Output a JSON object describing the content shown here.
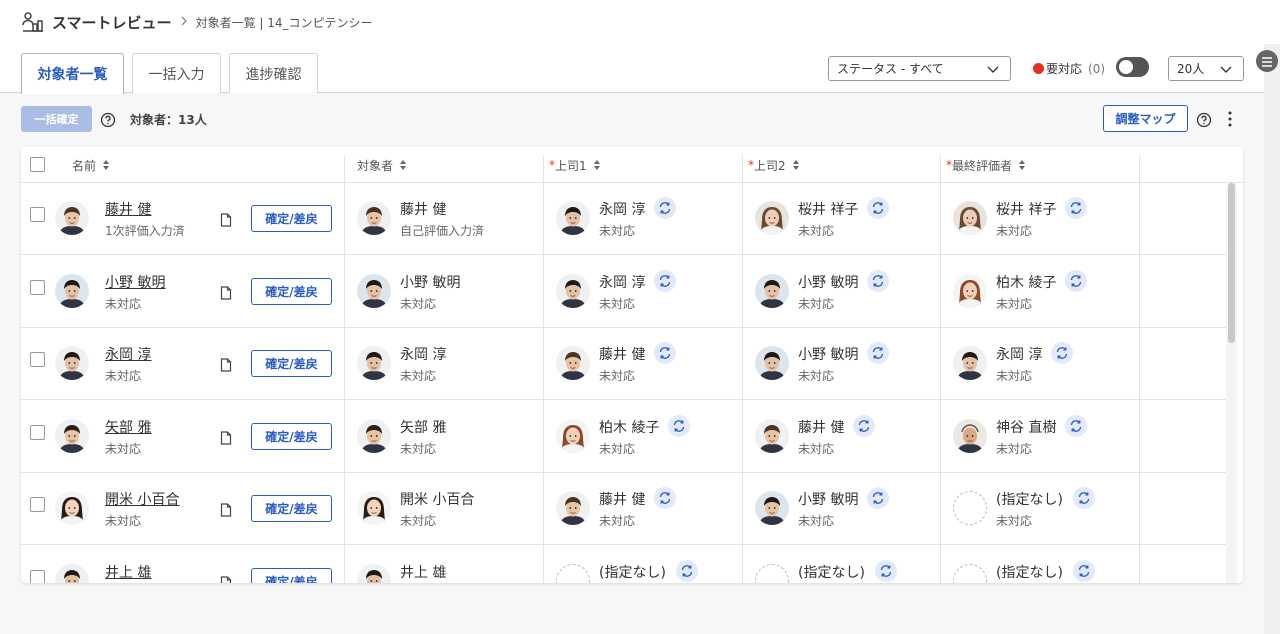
{
  "header": {
    "app_title": "スマートレビュー",
    "breadcrumb": "対象者一覧 | 14_コンピテンシー"
  },
  "tabs": [
    {
      "label": "対象者一覧",
      "active": true
    },
    {
      "label": "一括入力",
      "active": false
    },
    {
      "label": "進捗確認",
      "active": false
    }
  ],
  "filters": {
    "status_value": "ステータス - すべて",
    "need_label": "要対応",
    "need_count": "(0)",
    "need_toggle_on": false,
    "per_page_value": "20人"
  },
  "toolbar": {
    "bulk_confirm_label": "一括確定",
    "count_label": "対象者：13人",
    "map_label": "調整マップ"
  },
  "table": {
    "columns": [
      {
        "label": "名前",
        "required": false
      },
      {
        "label": "対象者",
        "required": false
      },
      {
        "label": "上司1",
        "required": true
      },
      {
        "label": "上司2",
        "required": true
      },
      {
        "label": "最終評価者",
        "required": true
      }
    ],
    "confirm_label": "確定/差戻",
    "required_mark": "*",
    "rows": [
      {
        "name": "藤井 健",
        "name_status": "1次評価入力済",
        "avatar": "fujii",
        "target": {
          "name": "藤井 健",
          "status": "自己評価入力済",
          "avatar": "fujii"
        },
        "boss1": {
          "name": "永岡 淳",
          "status": "未対応",
          "avatar": "nagaoka"
        },
        "boss2": {
          "name": "桜井 祥子",
          "status": "未対応",
          "avatar": "sakurai"
        },
        "final": {
          "name": "桜井 祥子",
          "status": "未対応",
          "avatar": "sakurai"
        }
      },
      {
        "name": "小野 敏明",
        "name_status": "未対応",
        "avatar": "ono",
        "target": {
          "name": "小野 敏明",
          "status": "未対応",
          "avatar": "ono"
        },
        "boss1": {
          "name": "永岡 淳",
          "status": "未対応",
          "avatar": "nagaoka"
        },
        "boss2": {
          "name": "小野 敏明",
          "status": "未対応",
          "avatar": "ono"
        },
        "final": {
          "name": "柏木 綾子",
          "status": "未対応",
          "avatar": "kashiwagi"
        }
      },
      {
        "name": "永岡 淳",
        "name_status": "未対応",
        "avatar": "nagaoka",
        "target": {
          "name": "永岡 淳",
          "status": "未対応",
          "avatar": "nagaoka"
        },
        "boss1": {
          "name": "藤井 健",
          "status": "未対応",
          "avatar": "fujii"
        },
        "boss2": {
          "name": "小野 敏明",
          "status": "未対応",
          "avatar": "ono"
        },
        "final": {
          "name": "永岡 淳",
          "status": "未対応",
          "avatar": "nagaoka"
        }
      },
      {
        "name": "矢部 雅",
        "name_status": "未対応",
        "avatar": "yabe",
        "target": {
          "name": "矢部 雅",
          "status": "未対応",
          "avatar": "yabe"
        },
        "boss1": {
          "name": "柏木 綾子",
          "status": "未対応",
          "avatar": "kashiwagi"
        },
        "boss2": {
          "name": "藤井 健",
          "status": "未対応",
          "avatar": "fujii"
        },
        "final": {
          "name": "神谷 直樹",
          "status": "未対応",
          "avatar": "kamiya"
        }
      },
      {
        "name": "開米 小百合",
        "name_status": "未対応",
        "avatar": "kaimai",
        "target": {
          "name": "開米 小百合",
          "status": "未対応",
          "avatar": "kaimai"
        },
        "boss1": {
          "name": "藤井 健",
          "status": "未対応",
          "avatar": "fujii"
        },
        "boss2": {
          "name": "小野 敏明",
          "status": "未対応",
          "avatar": "ono"
        },
        "final": {
          "name": "(指定なし)",
          "status": "未対応",
          "avatar": "none"
        }
      },
      {
        "name": "井上 雄",
        "name_status": "",
        "avatar": "inoue",
        "target": {
          "name": "井上 雄",
          "status": "",
          "avatar": "inoue"
        },
        "boss1": {
          "name": "(指定なし)",
          "status": "",
          "avatar": "none"
        },
        "boss2": {
          "name": "(指定なし)",
          "status": "",
          "avatar": "none"
        },
        "final": {
          "name": "(指定なし)",
          "status": "",
          "avatar": "none"
        }
      }
    ]
  },
  "colors": {
    "accent": "#2a5cc5",
    "required": "#e0321e",
    "swap_bg": "#e2e9f8"
  }
}
